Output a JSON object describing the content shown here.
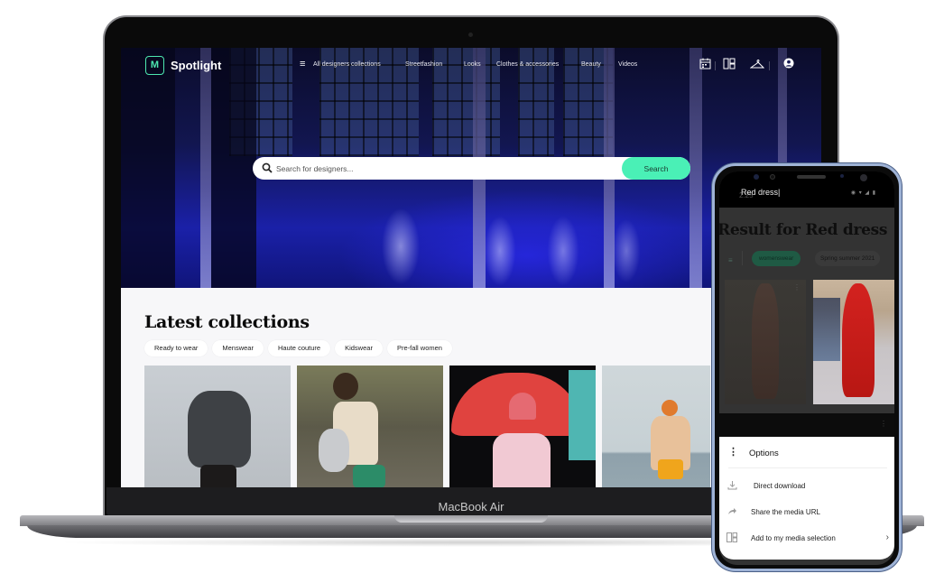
{
  "device_labels": {
    "laptop_model": "MacBook Air"
  },
  "site": {
    "brand_name": "Spotlight",
    "brand_icon": "m-logo-icon",
    "accent_color": "#4af0b6",
    "nav": {
      "menu_icon": "hamburger-icon",
      "links": [
        {
          "label": "All designers collections"
        },
        {
          "label": "Streetfashion"
        },
        {
          "label": "Looks"
        },
        {
          "label": "Clothes & accessories"
        },
        {
          "label": "Beauty"
        },
        {
          "label": "Videos"
        }
      ],
      "icons": [
        {
          "name": "calendar-icon",
          "glyph": "▦"
        },
        {
          "name": "layout-grid-icon",
          "glyph": "◫"
        },
        {
          "name": "hanger-icon",
          "glyph": "⏏"
        },
        {
          "name": "account-icon",
          "glyph": "●"
        }
      ]
    },
    "search": {
      "placeholder": "Search for designers...",
      "value": "",
      "button_label": "Search"
    },
    "latest": {
      "title": "Latest collections",
      "categories": [
        {
          "label": "Ready to wear"
        },
        {
          "label": "Menswear"
        },
        {
          "label": "Haute couture"
        },
        {
          "label": "Kidswear"
        },
        {
          "label": "Pre-fall women"
        }
      ],
      "tiles": [
        {
          "alt": "Model in grey knit sweater"
        },
        {
          "alt": "Model on railway tracks with tote bag"
        },
        {
          "alt": "Child with red umbrella on runway"
        },
        {
          "alt": "Model in orange outfit by the sea"
        }
      ]
    }
  },
  "phone": {
    "search_query": "Red dress",
    "status_time": "2:25",
    "result_title": "Result for Red dress",
    "filters": {
      "icon": "filter-icon",
      "chips": [
        {
          "label": "womenswear",
          "active": true
        },
        {
          "label": "Spring summer 2021",
          "active": false
        }
      ]
    },
    "results": [
      {
        "alt": "Strapless brown sequin dress"
      },
      {
        "alt": "Red high-neck gown on runway"
      }
    ],
    "options_sheet": {
      "title": "Options",
      "items": [
        {
          "label": "Direct download",
          "icon": "download-icon"
        },
        {
          "label": "Share the media URL",
          "icon": "share-icon"
        },
        {
          "label": "Add to my media selection",
          "icon": "media-selection-icon",
          "has_submenu": true
        }
      ]
    }
  }
}
